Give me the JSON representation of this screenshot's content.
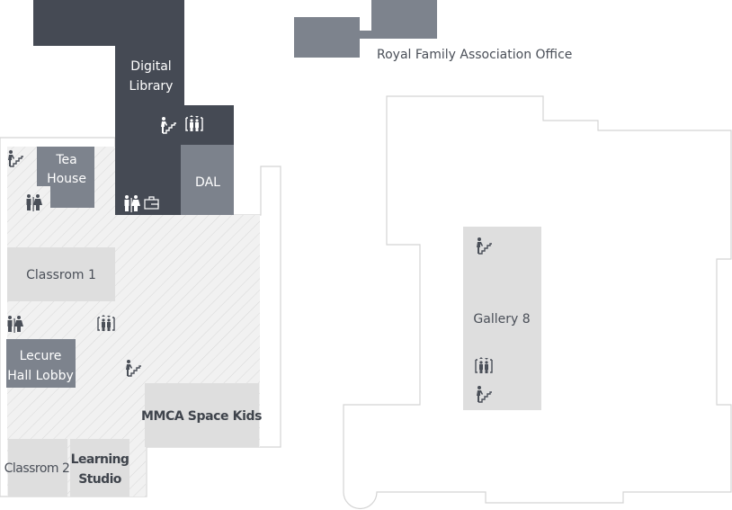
{
  "map": {
    "colors": {
      "dark_block": "#454a54",
      "mid_room": "#7d838d",
      "light_room": "#dedede",
      "hatched_floor": "#f1f1f1",
      "outline": "#d4d4d4",
      "icon_dark": "#4a4f58",
      "icon_light": "#ffffff"
    },
    "rooms": {
      "digital_library": [
        "Digital",
        "Library"
      ],
      "dal": "DAL",
      "tea_house": [
        "Tea",
        "House"
      ],
      "classroom_1": "Classrom 1",
      "lecture_hall_lobby": [
        "Lecure",
        "Hall Lobby"
      ],
      "mmca_space_kids": "MMCA Space Kids",
      "classroom_2": "Classrom 2",
      "learning_studio": [
        "Learning",
        "Studio"
      ],
      "royal_family_office": "Royal Family Association Office",
      "gallery_8": "Gallery 8"
    },
    "icons": [
      "stairs-icon",
      "elevator-icon",
      "restroom-icon",
      "locker-icon"
    ]
  }
}
